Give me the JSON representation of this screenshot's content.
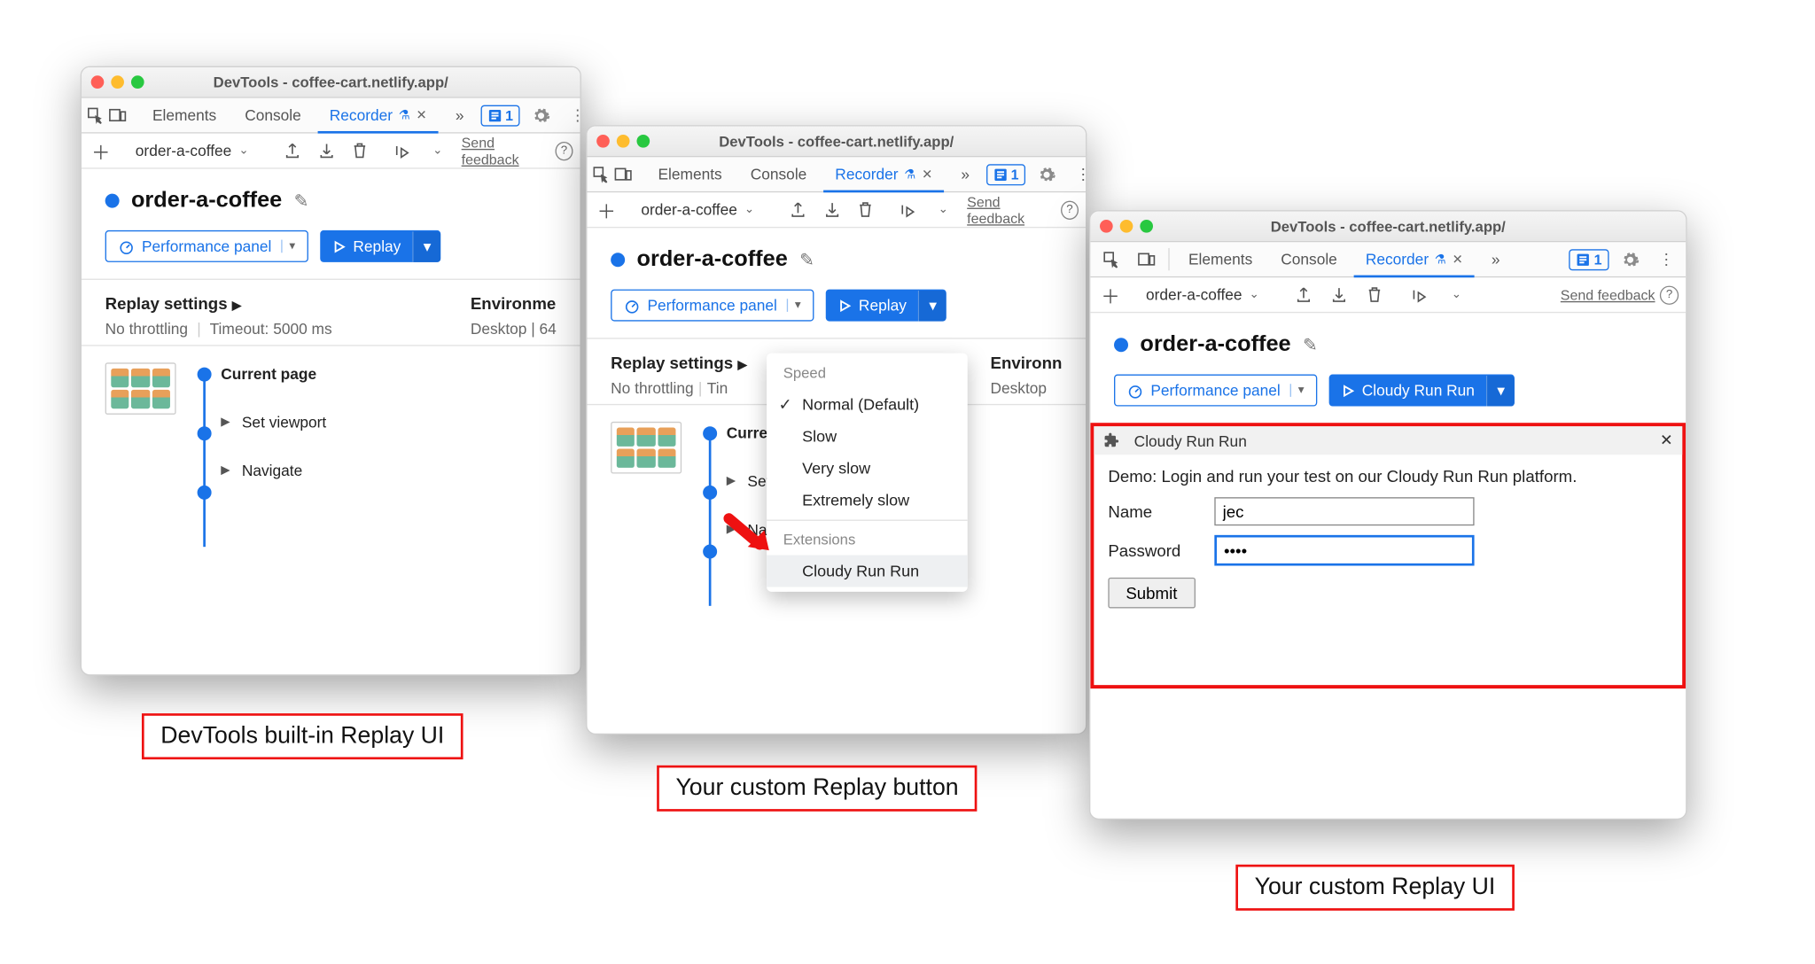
{
  "windowTitle": "DevTools - coffee-cart.netlify.app/",
  "tabs": {
    "elements": "Elements",
    "console": "Console",
    "recorder": "Recorder",
    "moreCount": "»",
    "issuesCount": "1"
  },
  "toolbar": {
    "recordingName": "order-a-coffee",
    "feedback": "Send feedback"
  },
  "recording": {
    "title": "order-a-coffee",
    "perfPanel": "Performance panel",
    "replay": "Replay",
    "cloudyReplay": "Cloudy Run Run",
    "settingsHead": "Replay settings",
    "noThrottling": "No throttling",
    "timeout": "Timeout: 5000 ms",
    "envHeadFull": "Environment",
    "envHeadCut1": "Environme",
    "envHeadCut2": "Environn",
    "envSubFull": "Desktop | 64",
    "envSubCut": "Desktop"
  },
  "steps": {
    "current": "Current page",
    "setViewport": "Set viewport",
    "navigate": "Navigate"
  },
  "menu": {
    "speed": "Speed",
    "normal": "Normal (Default)",
    "slow": "Slow",
    "verySlow": "Very slow",
    "extremelySlow": "Extremely slow",
    "extensions": "Extensions",
    "cloudy": "Cloudy Run Run"
  },
  "cloudyPanel": {
    "title": "Cloudy Run Run",
    "intro": "Demo: Login and run your test on our Cloudy Run Run platform.",
    "nameLabel": "Name",
    "nameValue": "jec",
    "passLabel": "Password",
    "passValue": "••••",
    "submit": "Submit"
  },
  "captions": {
    "c1": "DevTools built-in Replay UI",
    "c2": "Your custom Replay button",
    "c3": "Your custom Replay UI"
  }
}
